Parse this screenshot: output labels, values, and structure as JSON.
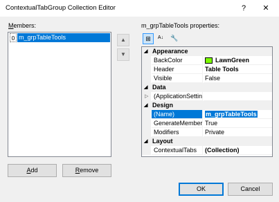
{
  "window": {
    "title": "ContextualTabGroup Collection Editor",
    "help": "?",
    "close": "✕"
  },
  "members": {
    "label_hotkey": "M",
    "label_rest": "embers:",
    "items": [
      {
        "index": "0",
        "name": "m_grpTableTools",
        "selected": true
      }
    ],
    "up_icon": "▲",
    "down_icon": "▼",
    "add_hotkey": "A",
    "add_rest": "dd",
    "remove_hotkey": "R",
    "remove_rest": "emove"
  },
  "properties": {
    "label": "m_grpTableTools properties:",
    "toolbar": {
      "categorized_icon": "⊞",
      "alpha_icon": "A↓",
      "pages_icon": "🔧"
    },
    "categories": [
      {
        "name": "Appearance",
        "expand_icon": "◢",
        "rows": [
          {
            "name": "BackColor",
            "value": "LawnGreen",
            "bold": true,
            "color": "#7CFC00"
          },
          {
            "name": "Header",
            "value": "Table Tools",
            "bold": true
          },
          {
            "name": "Visible",
            "value": "False"
          }
        ]
      },
      {
        "name": "Data",
        "expand_icon": "◢",
        "rows": [
          {
            "name": "(ApplicationSettings)",
            "value": "",
            "expandable": true,
            "expand_icon": "▷"
          }
        ]
      },
      {
        "name": "Design",
        "expand_icon": "◢",
        "rows": [
          {
            "name": "(Name)",
            "value": "m_grpTableTools",
            "bold": true,
            "selected": true
          },
          {
            "name": "GenerateMember",
            "value": "True"
          },
          {
            "name": "Modifiers",
            "value": "Private"
          }
        ]
      },
      {
        "name": "Layout",
        "expand_icon": "◢",
        "rows": [
          {
            "name": "ContextualTabs",
            "value": "(Collection)",
            "bold": true
          }
        ]
      }
    ]
  },
  "buttons": {
    "ok": "OK",
    "cancel": "Cancel"
  },
  "colors": {
    "selection": "#0078d7",
    "lawngreen": "#7CFC00"
  }
}
